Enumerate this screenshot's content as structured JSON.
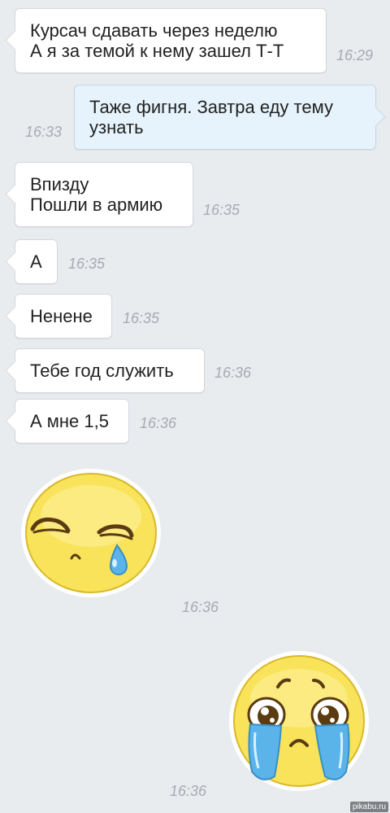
{
  "messages": [
    {
      "lines": [
        "Курсач сдавать через неделю",
        "А я за темой к нему зашел Т-Т"
      ],
      "time": "16:29",
      "direction": "in"
    },
    {
      "lines": [
        "Таже фигня. Завтра еду тему",
        "узнать"
      ],
      "time": "16:33",
      "direction": "out"
    },
    {
      "lines": [
        "Впизду",
        "Пошли в армию"
      ],
      "time": "16:35",
      "direction": "in"
    },
    {
      "lines": [
        "А"
      ],
      "time": "16:35",
      "direction": "in"
    },
    {
      "lines": [
        "Ненене"
      ],
      "time": "16:35",
      "direction": "in"
    },
    {
      "lines": [
        "Тебе год служить"
      ],
      "time": "16:36",
      "direction": "in"
    },
    {
      "lines": [
        "А мне 1,5"
      ],
      "time": "16:36",
      "direction": "in"
    }
  ],
  "stickers": [
    {
      "name": "sad-tear-emoji",
      "time": "16:36",
      "direction": "in"
    },
    {
      "name": "crying-emoji",
      "time": "16:36",
      "direction": "out"
    }
  ],
  "watermark": "pikabu.ru",
  "colors": {
    "background": "#e9ecef",
    "incoming_bubble": "#ffffff",
    "outgoing_bubble": "#e6f3fc",
    "timestamp": "#a7abb0",
    "emoji_face": "#f8e35a",
    "tears": "#5ab4ea"
  }
}
